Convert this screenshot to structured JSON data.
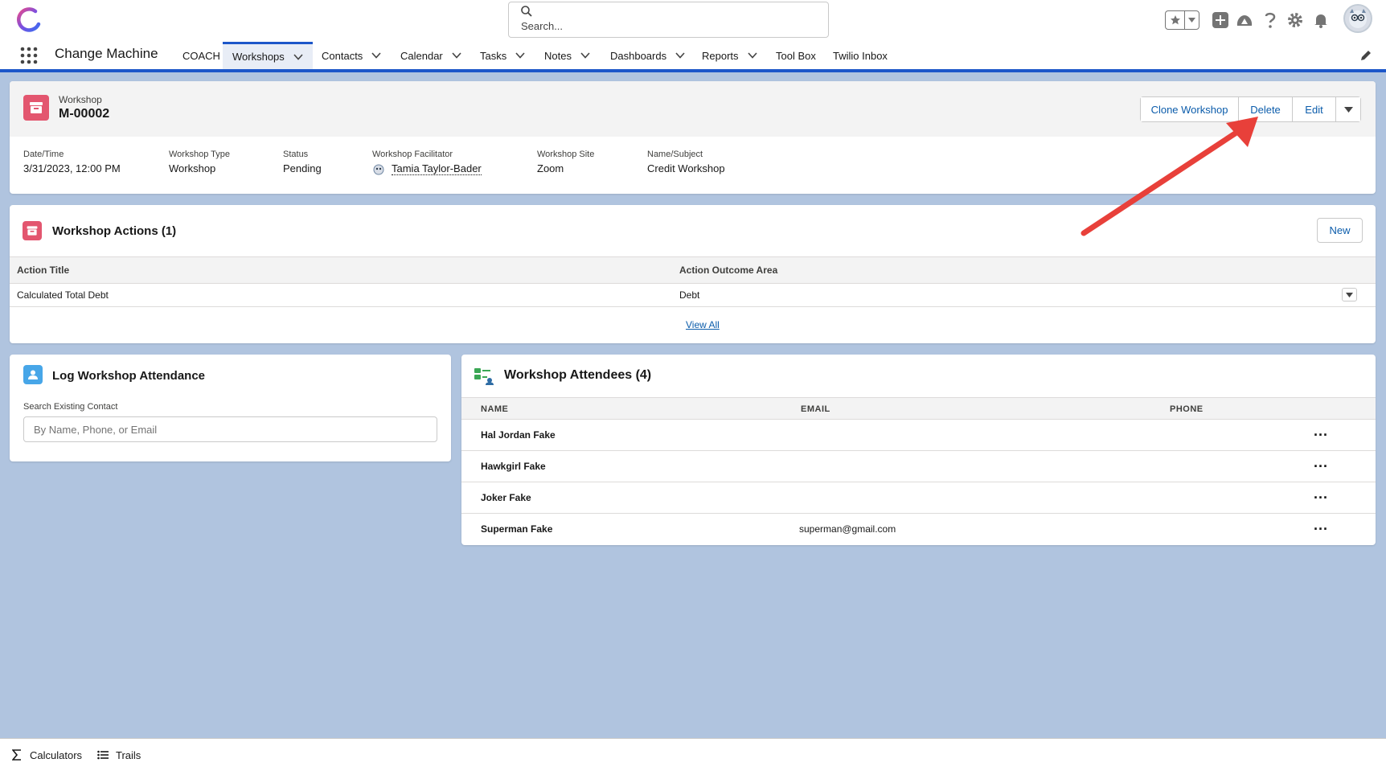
{
  "header": {
    "search_placeholder": "Search..."
  },
  "nav": {
    "app_name": "Change Machine",
    "items": [
      {
        "label": "COACH",
        "dropdown": false
      },
      {
        "label": "Workshops",
        "dropdown": true,
        "active": true
      },
      {
        "label": "Contacts",
        "dropdown": true
      },
      {
        "label": "Calendar",
        "dropdown": true
      },
      {
        "label": "Tasks",
        "dropdown": true
      },
      {
        "label": "Notes",
        "dropdown": true
      },
      {
        "label": "Dashboards",
        "dropdown": true
      },
      {
        "label": "Reports",
        "dropdown": true
      },
      {
        "label": "Tool Box",
        "dropdown": false
      },
      {
        "label": "Twilio Inbox",
        "dropdown": false
      }
    ]
  },
  "record": {
    "type_label": "Workshop",
    "name": "M-00002",
    "buttons": {
      "clone": "Clone Workshop",
      "delete": "Delete",
      "edit": "Edit"
    },
    "fields": {
      "datetime_label": "Date/Time",
      "datetime_value": "3/31/2023, 12:00 PM",
      "type_label": "Workshop Type",
      "type_value": "Workshop",
      "status_label": "Status",
      "status_value": "Pending",
      "facilitator_label": "Workshop Facilitator",
      "facilitator_value": "Tamia Taylor-Bader",
      "site_label": "Workshop Site",
      "site_value": "Zoom",
      "subject_label": "Name/Subject",
      "subject_value": "Credit Workshop"
    }
  },
  "actions": {
    "title": "Workshop Actions (1)",
    "new_label": "New",
    "columns": [
      "Action Title",
      "Action Outcome Area"
    ],
    "rows": [
      {
        "title": "Calculated Total Debt",
        "area": "Debt"
      }
    ],
    "view_all": "View All"
  },
  "log": {
    "title": "Log Workshop Attendance",
    "search_label": "Search Existing Contact",
    "search_placeholder": "By Name, Phone, or Email"
  },
  "attendees": {
    "title": "Workshop Attendees (4)",
    "columns": [
      "NAME",
      "EMAIL",
      "PHONE"
    ],
    "rows": [
      {
        "name": "Hal Jordan Fake",
        "email": ""
      },
      {
        "name": "Hawkgirl Fake",
        "email": ""
      },
      {
        "name": "Joker Fake",
        "email": ""
      },
      {
        "name": "Superman Fake",
        "email": "superman@gmail.com"
      }
    ],
    "more_label": "..."
  },
  "utility": {
    "calculators": "Calculators",
    "trails": "Trails"
  },
  "colors": {
    "brand_blue": "#1c56c9",
    "link_blue": "#0b5cab",
    "background": "#b0c4df",
    "workshop_icon": "#e3566f",
    "annotation_arrow": "#e8403a"
  },
  "icons": [
    "app-logo-icon",
    "search-icon",
    "star-icon",
    "add-icon",
    "trailhead-icon",
    "help-icon",
    "gear-icon",
    "bell-icon",
    "avatar",
    "app-launcher-icon",
    "pencil-icon",
    "workshop-icon",
    "contact-icon",
    "attendees-icon",
    "sigma-icon",
    "list-icon"
  ]
}
